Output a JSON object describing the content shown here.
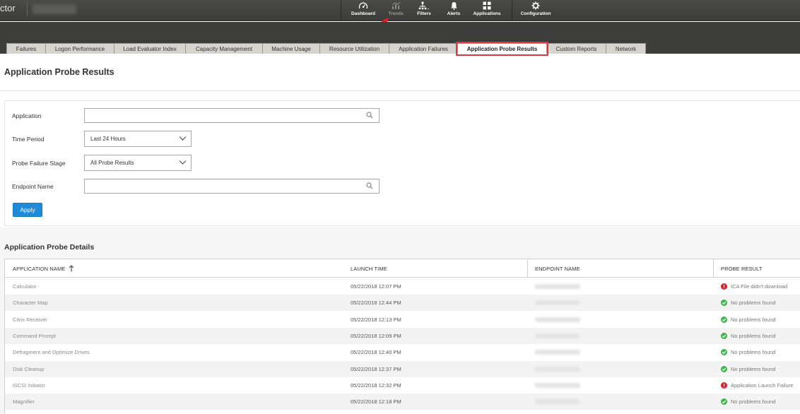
{
  "app": {
    "brand_text": "ctor"
  },
  "nav": [
    {
      "key": "dashboard",
      "label": "Dashboard",
      "icon": "dashboard-icon"
    },
    {
      "key": "trends",
      "label": "Trends",
      "icon": "trends-icon"
    },
    {
      "key": "filters",
      "label": "Filters",
      "icon": "filters-icon"
    },
    {
      "key": "alerts",
      "label": "Alerts",
      "icon": "bell-icon"
    },
    {
      "key": "applications",
      "label": "Applications",
      "icon": "grid-icon"
    },
    {
      "key": "configuration",
      "label": "Configuration",
      "icon": "gear-icon"
    }
  ],
  "tabs": [
    "Failures",
    "Logon Performance",
    "Load Evaluator Index",
    "Capacity Management",
    "Machine Usage",
    "Resource Utilization",
    "Application Failures",
    "Application Probe Results",
    "Custom Reports",
    "Network"
  ],
  "active_tab": "Application Probe Results",
  "page": {
    "title": "Application Probe Results"
  },
  "filters": {
    "application_label": "Application",
    "application_value": "",
    "time_period_label": "Time Period",
    "time_period_value": "Last 24 Hours",
    "failure_stage_label": "Probe Failure Stage",
    "failure_stage_value": "All Probe Results",
    "endpoint_label": "Endpoint Name",
    "endpoint_value": "",
    "apply_label": "Apply"
  },
  "details": {
    "title": "Application Probe Details",
    "columns": [
      "APPLICATION NAME",
      "LAUNCH TIME",
      "ENDPOINT NAME",
      "PROBE RESULT"
    ],
    "rows": [
      {
        "app": "Calculator",
        "time": "05/22/2018 12:07 PM",
        "result": "ICA File didn't download",
        "status": "error"
      },
      {
        "app": "Character Map",
        "time": "05/22/2018 12:44 PM",
        "result": "No problems found",
        "status": "ok"
      },
      {
        "app": "Citrix Receiver",
        "time": "05/22/2018 12:13 PM",
        "result": "No problems found",
        "status": "ok"
      },
      {
        "app": "Command Prompt",
        "time": "05/22/2018 12:09 PM",
        "result": "No problems found",
        "status": "ok"
      },
      {
        "app": "Defragment and Optimize Drives",
        "time": "05/22/2018 12:40 PM",
        "result": "No problems found",
        "status": "ok"
      },
      {
        "app": "Disk Cleanup",
        "time": "05/22/2018 12:37 PM",
        "result": "No problems found",
        "status": "ok"
      },
      {
        "app": "iSCSI Initiator",
        "time": "05/22/2018 12:32 PM",
        "result": "Application Launch Failure",
        "status": "error"
      },
      {
        "app": "Magnifier",
        "time": "05/22/2018 12:18 PM",
        "result": "No problems found",
        "status": "ok"
      }
    ]
  },
  "colors": {
    "accent": "#1f8ad7",
    "highlight": "#e0343f",
    "ok": "#3db54a",
    "error": "#e0202a",
    "topbar": "#444442"
  }
}
